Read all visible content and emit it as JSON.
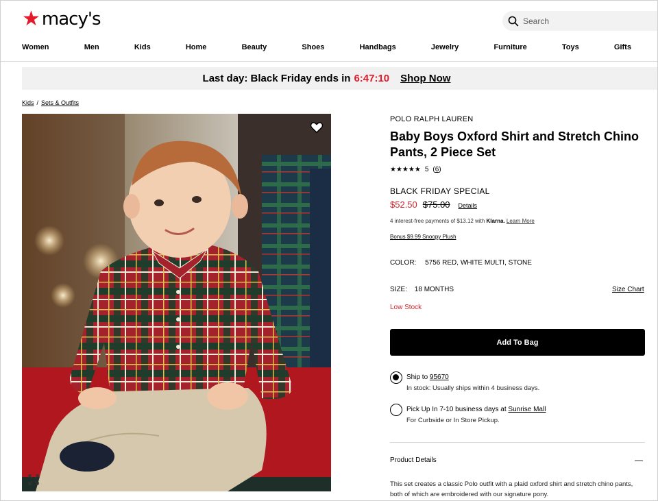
{
  "header": {
    "logo_text": "macy's",
    "search_placeholder": "Search"
  },
  "nav": [
    "Women",
    "Men",
    "Kids",
    "Home",
    "Beauty",
    "Shoes",
    "Handbags",
    "Jewelry",
    "Furniture",
    "Toys",
    "Gifts"
  ],
  "promo": {
    "text": "Last day: Black Friday ends in",
    "timer": "6:47:10",
    "link": "Shop Now"
  },
  "breadcrumb": [
    "Kids",
    "Sets & Outfits"
  ],
  "breadcrumb_sep": "/",
  "product": {
    "brand": "POLO RALPH LAUREN",
    "title": "Baby Boys Oxford Shirt and Stretch Chino Pants, 2 Piece Set",
    "stars": "★★★★★",
    "rating_value": "5",
    "rating_count": "6",
    "rating": 5,
    "special_label": "BLACK FRIDAY SPECIAL",
    "sale_price": "$52.50",
    "original_price": "$75.00",
    "details_link": "Details",
    "klarna_text": "4 interest-free payments of $13.12 with",
    "klarna_brand": "Klarna.",
    "klarna_link": "Learn More",
    "bonus_link": "Bonus $9.99 Snoopy Plush",
    "color_label": "COLOR:",
    "color_value": "5756 RED, WHITE MULTI, STONE",
    "size_label": "SIZE:",
    "size_value": "18 MONTHS",
    "size_chart": "Size Chart",
    "stock_status": "Low Stock",
    "add_to_bag": "Add To Bag"
  },
  "fulfillment": {
    "ship_label": "Ship to",
    "ship_zip": "95670",
    "ship_sub": "In stock: Usually ships within 4 business days.",
    "pickup_label": "Pick Up In 7-10 business days at",
    "pickup_store": "Sunrise Mall",
    "pickup_sub": "For Curbside or In Store Pickup."
  },
  "product_details": {
    "title": "Product Details",
    "toggle": "—",
    "description": "This set creates a classic Polo outfit with a plaid oxford shirt and stretch chino pants, both of which are embroidered with our signature pony."
  },
  "colors": {
    "brand_red": "#e21a2c",
    "sale_red": "#d1232a",
    "promo_bg": "#f1f1f1",
    "button_bg": "#000000"
  }
}
